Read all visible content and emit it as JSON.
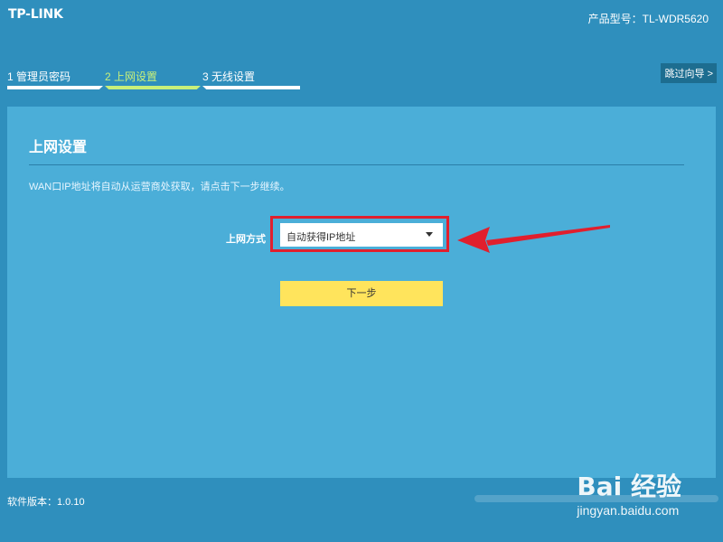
{
  "header": {
    "brand": "TP-LINK",
    "model": "产品型号：TL-WDR5620"
  },
  "wizard": {
    "steps": [
      {
        "label": "1 管理员密码"
      },
      {
        "label": "2 上网设置"
      },
      {
        "label": "3 无线设置"
      }
    ],
    "active_step": 2,
    "skip_label": "跳过向导 >"
  },
  "panel": {
    "title": "上网设置",
    "description": "WAN口IP地址将自动从运营商处获取，请点击下一步继续。",
    "field_label": "上网方式",
    "select_value": "自动获得IP地址",
    "next_label": "下一步"
  },
  "footer": {
    "version": "软件版本：1.0.10"
  },
  "watermark": {
    "main": "Bai 经验",
    "sub": "jingyan.baidu.com"
  },
  "colors": {
    "background": "#2f8fbd",
    "panel": "#4baed8",
    "active_step": "#c8f07a",
    "button": "#ffe45c",
    "highlight": "#e11f2d"
  }
}
